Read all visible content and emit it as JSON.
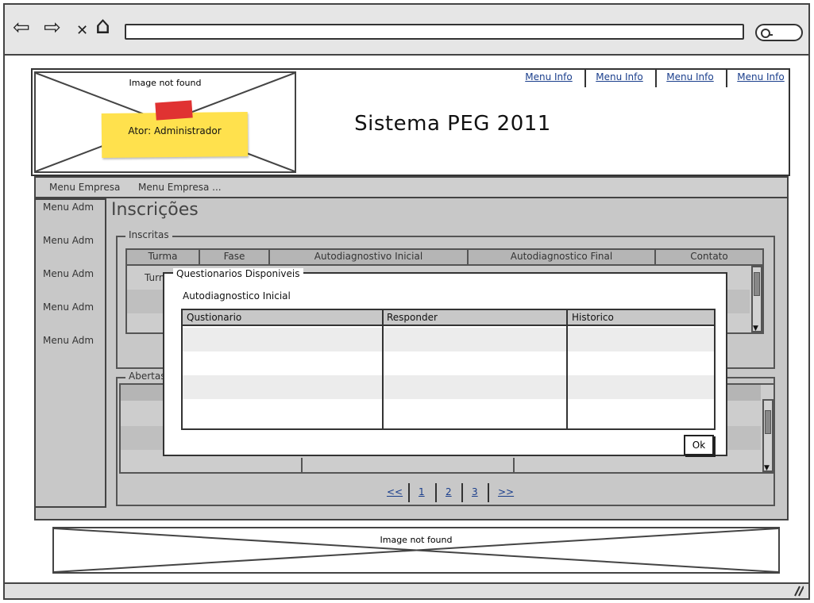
{
  "browser": {
    "nav": {
      "back": "⇦",
      "forward": "⇨",
      "close": "✕",
      "home": "⌂"
    }
  },
  "header": {
    "logo_placeholder": "Image not found",
    "sticky_note": "Ator: Administrador",
    "title": "Sistema PEG 2011",
    "top_menu": [
      "Menu Info",
      "Menu Info",
      "Menu Info",
      "Menu Info"
    ]
  },
  "menubar": {
    "items": [
      "Menu Empresa",
      "Menu Empresa ..."
    ]
  },
  "sidebar": {
    "items": [
      "Menu Adm",
      "Menu Adm",
      "Menu Adm",
      "Menu Adm",
      "Menu Adm"
    ]
  },
  "main": {
    "heading": "Inscrições",
    "inscritas": {
      "legend": "Inscritas",
      "columns": [
        "Turma",
        "Fase",
        "Autodiagnostivo Inicial",
        "Autodiagnostico Final",
        "Contato"
      ],
      "first_cell": "Turma"
    },
    "abertas": {
      "legend": "Abertas"
    },
    "pagination": [
      "<<",
      "1",
      "2",
      "3",
      ">>"
    ]
  },
  "modal": {
    "legend": "Questionarios Disponiveis",
    "subtitle": "Autodiagnostico Inicial",
    "columns": [
      "Qustionario",
      "Responder",
      "Historico"
    ],
    "ok_label": "Ok"
  },
  "footer": {
    "placeholder": "Image not found"
  }
}
